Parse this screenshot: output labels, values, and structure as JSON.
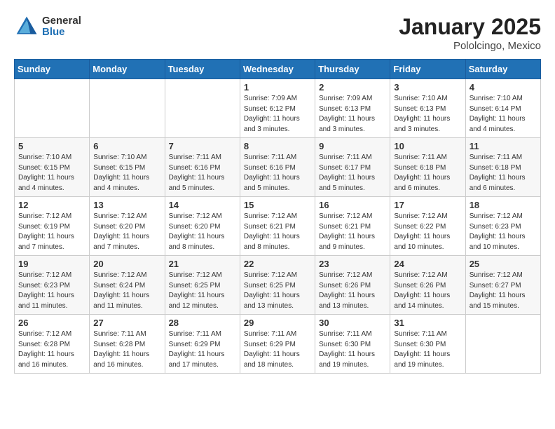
{
  "header": {
    "logo": {
      "general": "General",
      "blue": "Blue"
    },
    "title": "January 2025",
    "location": "Pololcingo, Mexico"
  },
  "days_of_week": [
    "Sunday",
    "Monday",
    "Tuesday",
    "Wednesday",
    "Thursday",
    "Friday",
    "Saturday"
  ],
  "weeks": [
    [
      {
        "day": "",
        "info": ""
      },
      {
        "day": "",
        "info": ""
      },
      {
        "day": "",
        "info": ""
      },
      {
        "day": "1",
        "info": "Sunrise: 7:09 AM\nSunset: 6:12 PM\nDaylight: 11 hours\nand 3 minutes."
      },
      {
        "day": "2",
        "info": "Sunrise: 7:09 AM\nSunset: 6:13 PM\nDaylight: 11 hours\nand 3 minutes."
      },
      {
        "day": "3",
        "info": "Sunrise: 7:10 AM\nSunset: 6:13 PM\nDaylight: 11 hours\nand 3 minutes."
      },
      {
        "day": "4",
        "info": "Sunrise: 7:10 AM\nSunset: 6:14 PM\nDaylight: 11 hours\nand 4 minutes."
      }
    ],
    [
      {
        "day": "5",
        "info": "Sunrise: 7:10 AM\nSunset: 6:15 PM\nDaylight: 11 hours\nand 4 minutes."
      },
      {
        "day": "6",
        "info": "Sunrise: 7:10 AM\nSunset: 6:15 PM\nDaylight: 11 hours\nand 4 minutes."
      },
      {
        "day": "7",
        "info": "Sunrise: 7:11 AM\nSunset: 6:16 PM\nDaylight: 11 hours\nand 5 minutes."
      },
      {
        "day": "8",
        "info": "Sunrise: 7:11 AM\nSunset: 6:16 PM\nDaylight: 11 hours\nand 5 minutes."
      },
      {
        "day": "9",
        "info": "Sunrise: 7:11 AM\nSunset: 6:17 PM\nDaylight: 11 hours\nand 5 minutes."
      },
      {
        "day": "10",
        "info": "Sunrise: 7:11 AM\nSunset: 6:18 PM\nDaylight: 11 hours\nand 6 minutes."
      },
      {
        "day": "11",
        "info": "Sunrise: 7:11 AM\nSunset: 6:18 PM\nDaylight: 11 hours\nand 6 minutes."
      }
    ],
    [
      {
        "day": "12",
        "info": "Sunrise: 7:12 AM\nSunset: 6:19 PM\nDaylight: 11 hours\nand 7 minutes."
      },
      {
        "day": "13",
        "info": "Sunrise: 7:12 AM\nSunset: 6:20 PM\nDaylight: 11 hours\nand 7 minutes."
      },
      {
        "day": "14",
        "info": "Sunrise: 7:12 AM\nSunset: 6:20 PM\nDaylight: 11 hours\nand 8 minutes."
      },
      {
        "day": "15",
        "info": "Sunrise: 7:12 AM\nSunset: 6:21 PM\nDaylight: 11 hours\nand 8 minutes."
      },
      {
        "day": "16",
        "info": "Sunrise: 7:12 AM\nSunset: 6:21 PM\nDaylight: 11 hours\nand 9 minutes."
      },
      {
        "day": "17",
        "info": "Sunrise: 7:12 AM\nSunset: 6:22 PM\nDaylight: 11 hours\nand 10 minutes."
      },
      {
        "day": "18",
        "info": "Sunrise: 7:12 AM\nSunset: 6:23 PM\nDaylight: 11 hours\nand 10 minutes."
      }
    ],
    [
      {
        "day": "19",
        "info": "Sunrise: 7:12 AM\nSunset: 6:23 PM\nDaylight: 11 hours\nand 11 minutes."
      },
      {
        "day": "20",
        "info": "Sunrise: 7:12 AM\nSunset: 6:24 PM\nDaylight: 11 hours\nand 11 minutes."
      },
      {
        "day": "21",
        "info": "Sunrise: 7:12 AM\nSunset: 6:25 PM\nDaylight: 11 hours\nand 12 minutes."
      },
      {
        "day": "22",
        "info": "Sunrise: 7:12 AM\nSunset: 6:25 PM\nDaylight: 11 hours\nand 13 minutes."
      },
      {
        "day": "23",
        "info": "Sunrise: 7:12 AM\nSunset: 6:26 PM\nDaylight: 11 hours\nand 13 minutes."
      },
      {
        "day": "24",
        "info": "Sunrise: 7:12 AM\nSunset: 6:26 PM\nDaylight: 11 hours\nand 14 minutes."
      },
      {
        "day": "25",
        "info": "Sunrise: 7:12 AM\nSunset: 6:27 PM\nDaylight: 11 hours\nand 15 minutes."
      }
    ],
    [
      {
        "day": "26",
        "info": "Sunrise: 7:12 AM\nSunset: 6:28 PM\nDaylight: 11 hours\nand 16 minutes."
      },
      {
        "day": "27",
        "info": "Sunrise: 7:11 AM\nSunset: 6:28 PM\nDaylight: 11 hours\nand 16 minutes."
      },
      {
        "day": "28",
        "info": "Sunrise: 7:11 AM\nSunset: 6:29 PM\nDaylight: 11 hours\nand 17 minutes."
      },
      {
        "day": "29",
        "info": "Sunrise: 7:11 AM\nSunset: 6:29 PM\nDaylight: 11 hours\nand 18 minutes."
      },
      {
        "day": "30",
        "info": "Sunrise: 7:11 AM\nSunset: 6:30 PM\nDaylight: 11 hours\nand 19 minutes."
      },
      {
        "day": "31",
        "info": "Sunrise: 7:11 AM\nSunset: 6:30 PM\nDaylight: 11 hours\nand 19 minutes."
      },
      {
        "day": "",
        "info": ""
      }
    ]
  ]
}
